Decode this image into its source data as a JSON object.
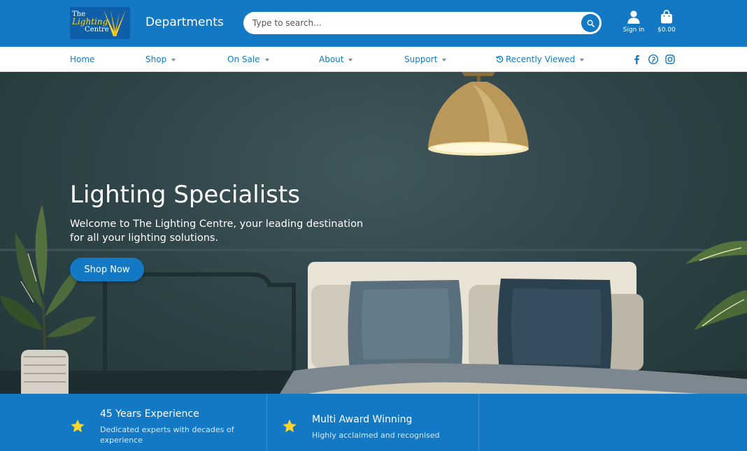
{
  "header": {
    "logo": {
      "line1": "The",
      "line2": "Lighting",
      "line3": "Centre"
    },
    "departments_label": "Departments",
    "search": {
      "placeholder": "Type to search...",
      "value": ""
    },
    "sign_in_label": "Sign in",
    "cart_total": "$0.00"
  },
  "nav": {
    "items": [
      {
        "label": "Home",
        "dropdown": false
      },
      {
        "label": "Shop",
        "dropdown": true
      },
      {
        "label": "On Sale",
        "dropdown": true
      },
      {
        "label": "About",
        "dropdown": true
      },
      {
        "label": "Support",
        "dropdown": true
      },
      {
        "label": "Recently Viewed",
        "dropdown": true,
        "icon": "history-icon"
      }
    ],
    "social": [
      "facebook-icon",
      "pinterest-icon",
      "instagram-icon"
    ]
  },
  "hero": {
    "title": "Lighting Specialists",
    "subtitle": "Welcome to The Lighting Centre, your leading destination for all your lighting solutions.",
    "cta_label": "Shop Now"
  },
  "features": [
    {
      "icon": "star-icon",
      "title": "45 Years Experience",
      "description": "Dedicated experts with decades of experience"
    },
    {
      "icon": "star-icon",
      "title": "Multi Award Winning",
      "description": "Highly acclaimed and recognised"
    }
  ],
  "colors": {
    "brand_blue": "#1479c4",
    "hero_wall": "#2f4448",
    "star_yellow": "#ffd526",
    "white": "#ffffff"
  }
}
